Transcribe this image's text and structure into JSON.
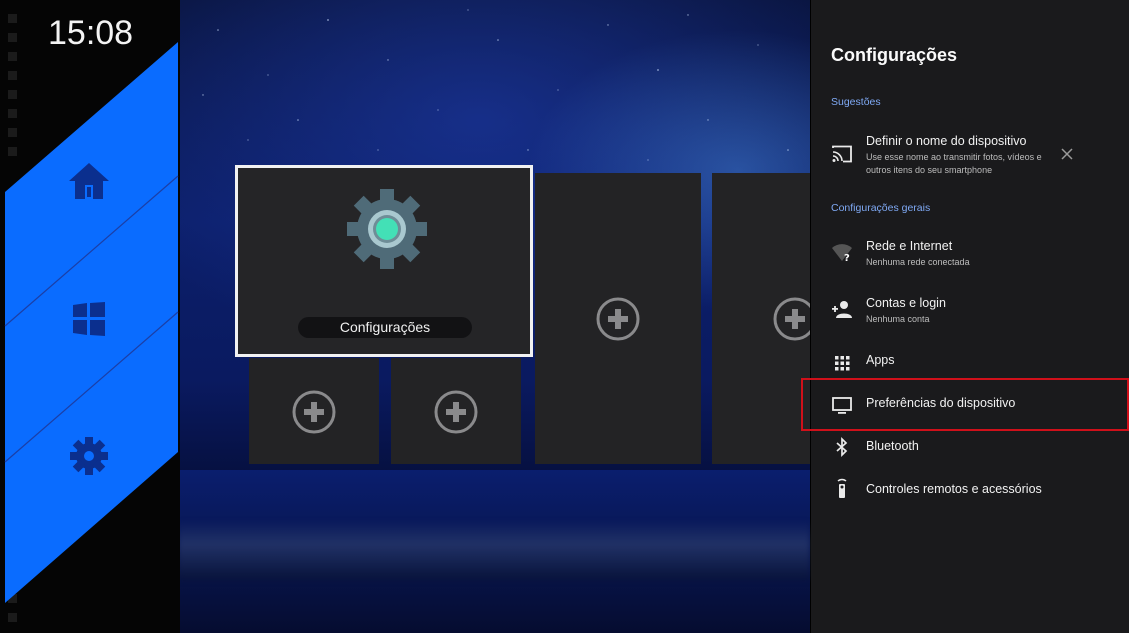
{
  "clock": {
    "time": "15:08"
  },
  "left_nav": {
    "accent_color": "#0a6cff",
    "items": [
      {
        "name": "home-icon"
      },
      {
        "name": "apps-grid-icon"
      },
      {
        "name": "settings-gear-icon"
      }
    ]
  },
  "launcher": {
    "selected_tile_label": "Configurações",
    "empty_tile_icon": "add-circle-icon"
  },
  "settings_panel": {
    "title": "Configurações",
    "suggestions_header": "Sugestões",
    "suggestion": {
      "title": "Definir o nome do dispositivo",
      "subtitle": "Use esse nome ao transmitir fotos, vídeos e outros itens do seu smartphone",
      "icon": "cast-icon",
      "dismiss_icon": "close-icon"
    },
    "general_header": "Configurações gerais",
    "items": [
      {
        "label": "Rede e Internet",
        "subtitle": "Nenhuma rede conectada",
        "icon": "wifi-question-icon"
      },
      {
        "label": "Contas e login",
        "subtitle": "Nenhuma conta",
        "icon": "add-person-icon"
      },
      {
        "label": "Apps",
        "subtitle": "",
        "icon": "apps-dots-icon"
      },
      {
        "label": "Preferências do dispositivo",
        "subtitle": "",
        "icon": "tv-icon"
      },
      {
        "label": "Bluetooth",
        "subtitle": "",
        "icon": "bluetooth-icon"
      },
      {
        "label": "Controles remotos e acessórios",
        "subtitle": "",
        "icon": "remote-icon"
      }
    ],
    "highlight_color": "#d0101a"
  }
}
